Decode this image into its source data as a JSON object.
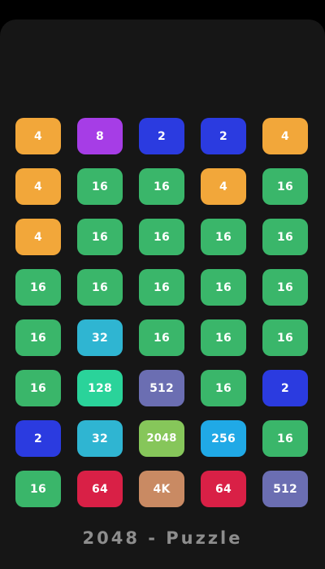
{
  "game": {
    "title": "2048 - Puzzle"
  },
  "colors": {
    "background": "#000000",
    "board": "#161616",
    "tile_2": "#2b3be0",
    "tile_4": "#f2a73a",
    "tile_8": "#a63de6",
    "tile_16": "#3ab66a",
    "tile_32": "#2fb5d2",
    "tile_64": "#d92046",
    "tile_128": "#2ad39a",
    "tile_256": "#20a9e6",
    "tile_512": "#6b6eb2",
    "tile_2048": "#86c65a",
    "tile_4K": "#c98a63",
    "title_text": "#8d8d8d"
  },
  "grid": {
    "rows": [
      [
        "4",
        "8",
        "2",
        "2",
        "4"
      ],
      [
        "4",
        "16",
        "16",
        "4",
        "16"
      ],
      [
        "4",
        "16",
        "16",
        "16",
        "16"
      ],
      [
        "16",
        "16",
        "16",
        "16",
        "16"
      ],
      [
        "16",
        "32",
        "16",
        "16",
        "16"
      ],
      [
        "16",
        "128",
        "512",
        "16",
        "2"
      ],
      [
        "2",
        "32",
        "2048",
        "256",
        "16"
      ],
      [
        "16",
        "64",
        "4K",
        "64",
        "512"
      ]
    ]
  }
}
